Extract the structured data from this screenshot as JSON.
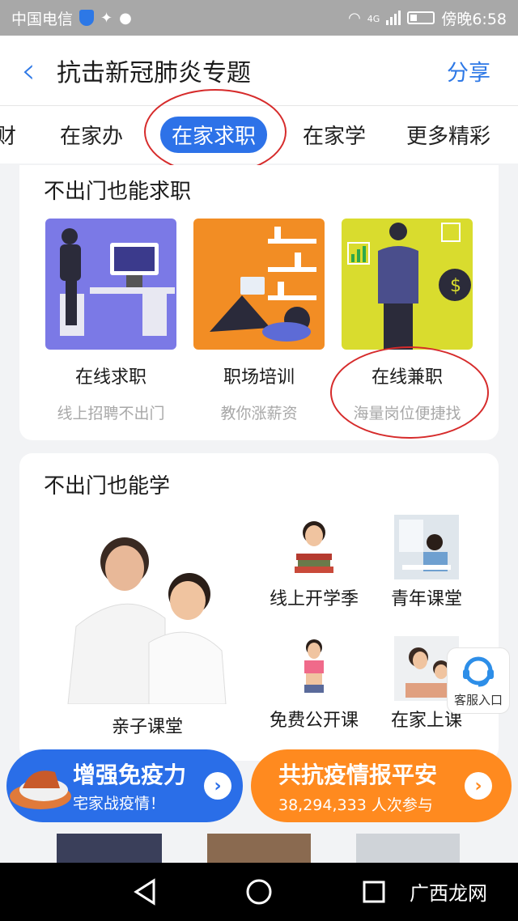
{
  "status_bar": {
    "carrier": "中国电信",
    "net": "4G",
    "time": "傍晚6:58"
  },
  "header": {
    "title": "抗击新冠肺炎专题",
    "share_label": "分享"
  },
  "tabs": [
    {
      "label": "财"
    },
    {
      "label": "在家办"
    },
    {
      "label": "在家求职",
      "active": true
    },
    {
      "label": "在家学"
    },
    {
      "label": "更多精彩"
    }
  ],
  "jobs_section": {
    "title": "不出门也能求职",
    "items": [
      {
        "name": "在线求职",
        "sub": "线上招聘不出门"
      },
      {
        "name": "职场培训",
        "sub": "教你涨薪资"
      },
      {
        "name": "在线兼职",
        "sub": "海量岗位便捷找"
      }
    ]
  },
  "learn_section": {
    "title": "不出门也能学",
    "main": {
      "label": "亲子课堂"
    },
    "items": [
      {
        "label": "线上开学季"
      },
      {
        "label": "青年课堂"
      },
      {
        "label": "免费公开课"
      },
      {
        "label": "在家上课"
      }
    ]
  },
  "service": {
    "label": "客服入口"
  },
  "banners": [
    {
      "title": "增强免疫力",
      "sub": "宅家战疫情！",
      "color": "#2a6ee8"
    },
    {
      "title": "共抗疫情报平安",
      "count": "38,294,333",
      "sub_suffix": "人次参与",
      "color": "#ff8a1f"
    }
  ],
  "watermark": "广西龙网",
  "colors": {
    "accent": "#2d72e8",
    "annotation": "#d62b2b",
    "status_bar": "#a8a8a8"
  }
}
